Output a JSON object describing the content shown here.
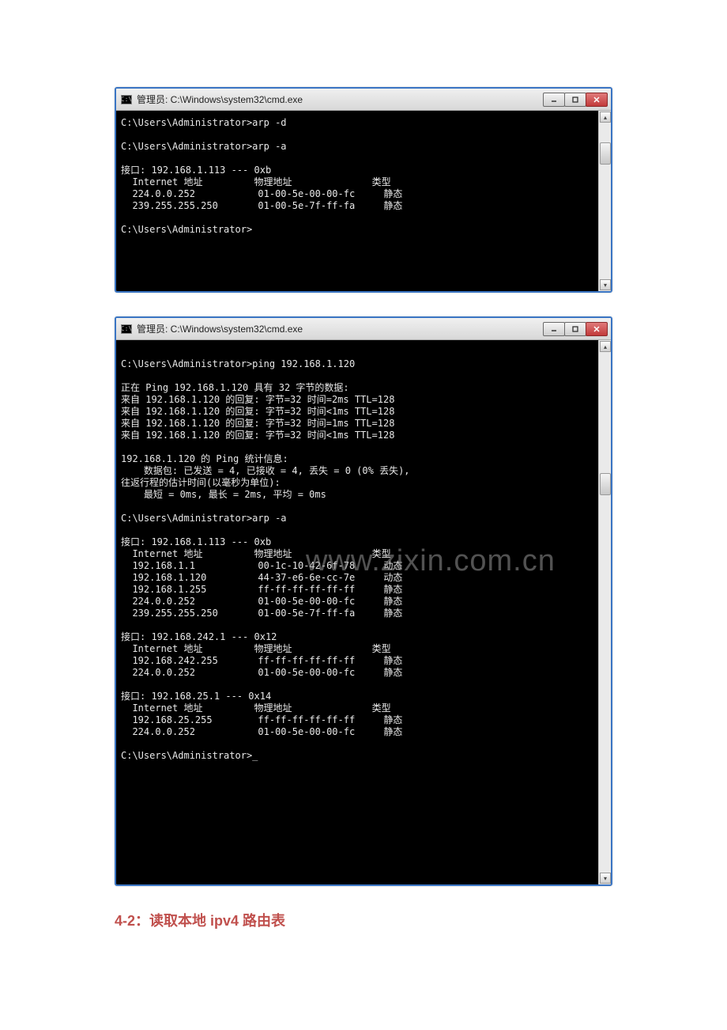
{
  "window1": {
    "title": "管理员: C:\\Windows\\system32\\cmd.exe",
    "icon_text": "C:\\",
    "lines": "C:\\Users\\Administrator>arp -d\n\nC:\\Users\\Administrator>arp -a\n\n接口: 192.168.1.113 --- 0xb\n  Internet 地址         物理地址              类型\n  224.0.0.252           01-00-5e-00-00-fc     静态\n  239.255.255.250       01-00-5e-7f-ff-fa     静态\n\nC:\\Users\\Administrator>\n\n\n"
  },
  "window2": {
    "title": "管理员: C:\\Windows\\system32\\cmd.exe",
    "icon_text": "C:\\",
    "lines": "\nC:\\Users\\Administrator>ping 192.168.1.120\n\n正在 Ping 192.168.1.120 具有 32 字节的数据:\n来自 192.168.1.120 的回复: 字节=32 时间=2ms TTL=128\n来自 192.168.1.120 的回复: 字节=32 时间<1ms TTL=128\n来自 192.168.1.120 的回复: 字节=32 时间=1ms TTL=128\n来自 192.168.1.120 的回复: 字节=32 时间<1ms TTL=128\n\n192.168.1.120 的 Ping 统计信息:\n    数据包: 已发送 = 4, 已接收 = 4, 丢失 = 0 (0% 丢失),\n往返行程的估计时间(以毫秒为单位):\n    最短 = 0ms, 最长 = 2ms, 平均 = 0ms\n\nC:\\Users\\Administrator>arp -a\n\n接口: 192.168.1.113 --- 0xb\n  Internet 地址         物理地址              类型\n  192.168.1.1           00-1c-10-42-6f-78     动态\n  192.168.1.120         44-37-e6-6e-cc-7e     动态\n  192.168.1.255         ff-ff-ff-ff-ff-ff     静态\n  224.0.0.252           01-00-5e-00-00-fc     静态\n  239.255.255.250       01-00-5e-7f-ff-fa     静态\n\n接口: 192.168.242.1 --- 0x12\n  Internet 地址         物理地址              类型\n  192.168.242.255       ff-ff-ff-ff-ff-ff     静态\n  224.0.0.252           01-00-5e-00-00-fc     静态\n\n接口: 192.168.25.1 --- 0x14\n  Internet 地址         物理地址              类型\n  192.168.25.255        ff-ff-ff-ff-ff-ff     静态\n  224.0.0.252           01-00-5e-00-00-fc     静态\n\nC:\\Users\\Administrator>_\n\n\n"
  },
  "watermark": "www.zixin.com.cn",
  "heading": "4-2：读取本地 ipv4 路由表"
}
